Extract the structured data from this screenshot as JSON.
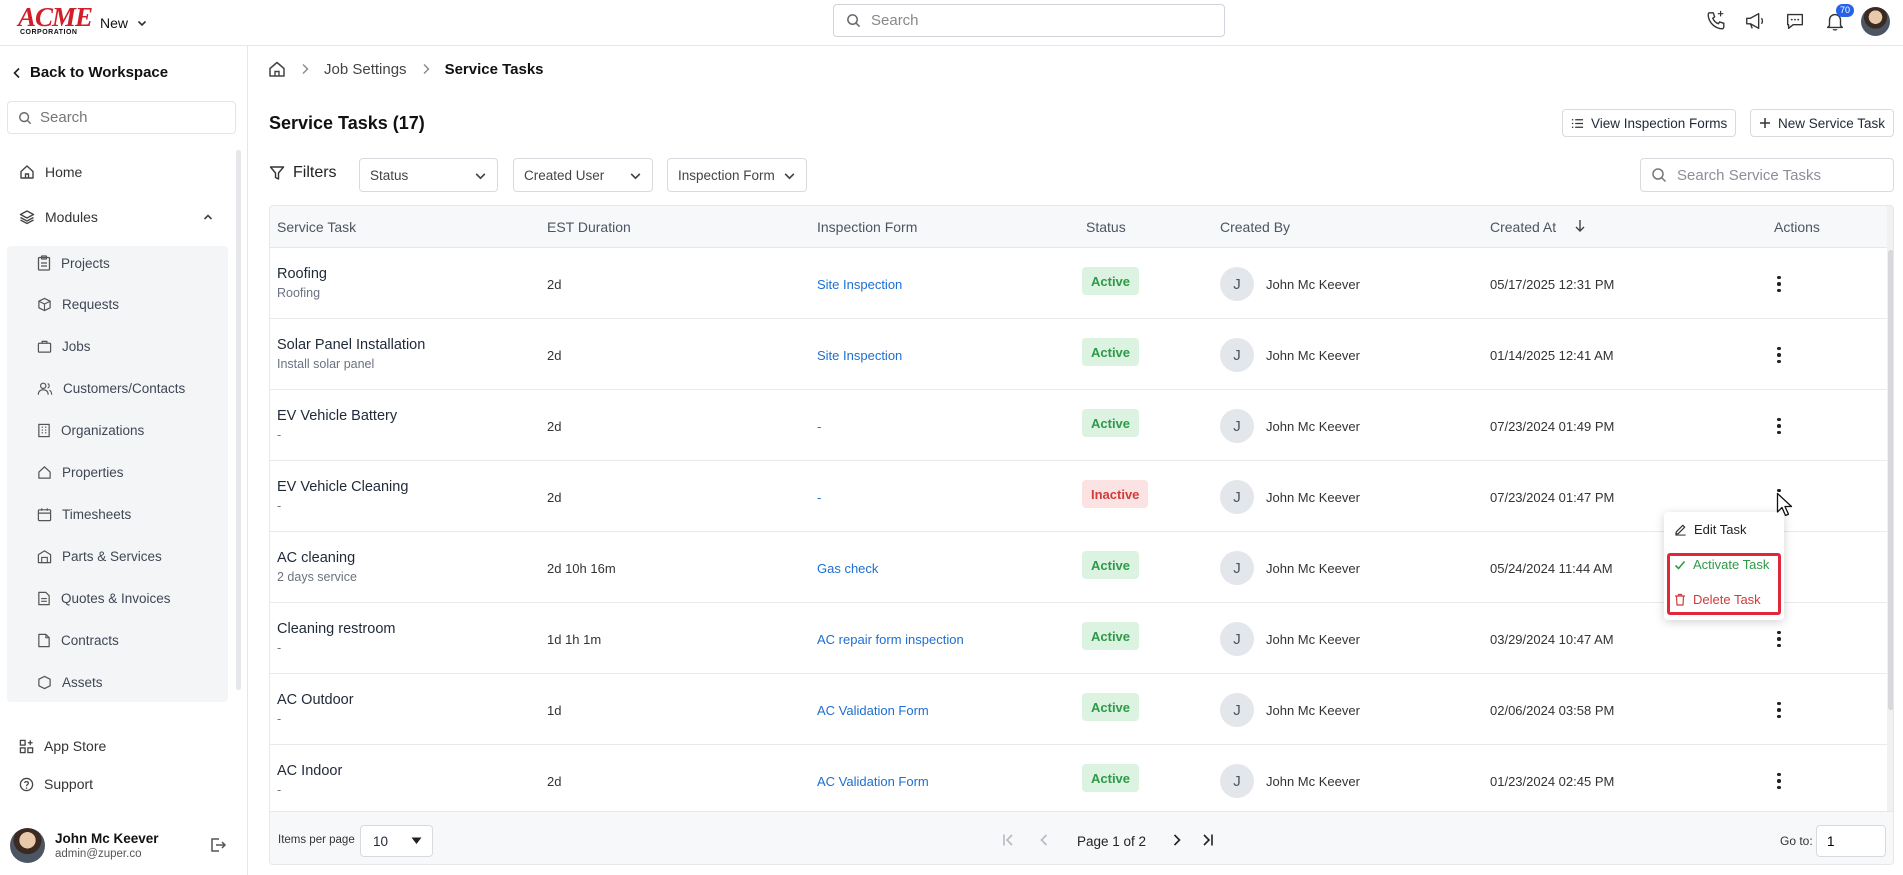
{
  "topbar": {
    "logo_text": "ACME",
    "logo_subtext": "CORPORATION",
    "new_label": "New",
    "search_placeholder": "Search",
    "notification_count": "70"
  },
  "sidebar": {
    "back_label": "Back to Workspace",
    "search_placeholder": "Search",
    "home_label": "Home",
    "modules_label": "Modules",
    "modules": [
      {
        "label": "Projects",
        "icon": "clipboard-icon"
      },
      {
        "label": "Requests",
        "icon": "box-icon"
      },
      {
        "label": "Jobs",
        "icon": "briefcase-icon"
      },
      {
        "label": "Customers/Contacts",
        "icon": "users-icon"
      },
      {
        "label": "Organizations",
        "icon": "building-icon"
      },
      {
        "label": "Properties",
        "icon": "home-icon"
      },
      {
        "label": "Timesheets",
        "icon": "calendar-icon"
      },
      {
        "label": "Parts & Services",
        "icon": "warehouse-icon"
      },
      {
        "label": "Quotes & Invoices",
        "icon": "document-icon"
      },
      {
        "label": "Contracts",
        "icon": "file-icon"
      },
      {
        "label": "Assets",
        "icon": "asset-icon"
      }
    ],
    "app_store_label": "App Store",
    "support_label": "Support",
    "user_name": "John Mc Keever",
    "user_email": "admin@zuper.co"
  },
  "breadcrumb": {
    "parent": "Job Settings",
    "current": "Service Tasks"
  },
  "page": {
    "title": "Service Tasks (17)",
    "view_forms_label": "View Inspection Forms",
    "new_task_label": "New Service Task"
  },
  "filters": {
    "label": "Filters",
    "status": "Status",
    "created_user": "Created User",
    "inspection_form": "Inspection Form",
    "search_placeholder": "Search Service Tasks"
  },
  "table": {
    "columns": [
      "Service Task",
      "EST Duration",
      "Inspection Form",
      "Status",
      "Created By",
      "Created At",
      "Actions"
    ],
    "rows": [
      {
        "name": "Roofing",
        "sub": "Roofing",
        "duration": "2d",
        "form": "Site Inspection",
        "status": "Active",
        "initial": "J",
        "created_by": "John Mc Keever",
        "created_at": "05/17/2025 12:31 PM"
      },
      {
        "name": "Solar Panel Installation",
        "sub": "Install solar panel",
        "duration": "2d",
        "form": "Site Inspection",
        "status": "Active",
        "initial": "J",
        "created_by": "John Mc Keever",
        "created_at": "01/14/2025 12:41 AM"
      },
      {
        "name": "EV Vehicle Battery",
        "sub": "-",
        "duration": "2d",
        "form": "-",
        "status": "Active",
        "initial": "J",
        "created_by": "John Mc Keever",
        "created_at": "07/23/2024 01:49 PM"
      },
      {
        "name": "EV Vehicle Cleaning",
        "sub": "-",
        "duration": "2d",
        "form": "-",
        "status": "Inactive",
        "initial": "J",
        "created_by": "John Mc Keever",
        "created_at": "07/23/2024 01:47 PM"
      },
      {
        "name": "AC cleaning",
        "sub": "2 days service",
        "duration": "2d 10h 16m",
        "form": "Gas check",
        "status": "Active",
        "initial": "J",
        "created_by": "John Mc Keever",
        "created_at": "05/24/2024 11:44 AM"
      },
      {
        "name": "Cleaning restroom",
        "sub": "-",
        "duration": "1d 1h 1m",
        "form": "AC repair form inspection",
        "status": "Active",
        "initial": "J",
        "created_by": "John Mc Keever",
        "created_at": "03/29/2024 10:47 AM"
      },
      {
        "name": "AC Outdoor",
        "sub": "-",
        "duration": "1d",
        "form": "AC Validation Form",
        "status": "Active",
        "initial": "J",
        "created_by": "John Mc Keever",
        "created_at": "02/06/2024 03:58 PM"
      },
      {
        "name": "AC Indoor",
        "sub": "-",
        "duration": "2d",
        "form": "AC Validation Form",
        "status": "Active",
        "initial": "J",
        "created_by": "John Mc Keever",
        "created_at": "01/23/2024 02:45 PM"
      }
    ]
  },
  "pagination": {
    "items_per_page_label": "Items per page",
    "items_per_page": "10",
    "page_text": "Page 1 of 2",
    "goto_label": "Go to:",
    "goto_value": "1"
  },
  "context_menu": {
    "edit": "Edit Task",
    "activate": "Activate Task",
    "delete": "Delete Task"
  },
  "colors": {
    "brand_red": "#d11f2a",
    "link_blue": "#1d6fd1",
    "active_green": "#2e9a48",
    "inactive_red": "#d13b3b",
    "highlight_red": "#e0283a"
  }
}
